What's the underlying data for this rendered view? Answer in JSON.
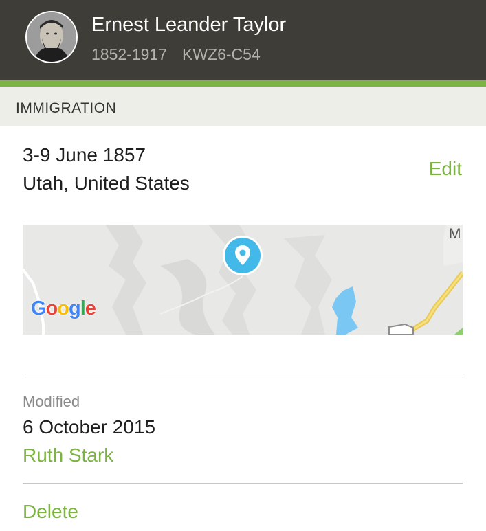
{
  "person": {
    "name": "Ernest Leander Taylor",
    "lifespan": "1852-1917",
    "pid": "KWZ6-C54"
  },
  "event": {
    "section_title": "IMMIGRATION",
    "date": "3-9 June 1857",
    "place": "Utah, United States",
    "edit_label": "Edit"
  },
  "map": {
    "brand": "Google",
    "corner_letter": "M",
    "pin_icon": "location-pin-icon"
  },
  "modified": {
    "label": "Modified",
    "date": "6 October 2015",
    "contributor": "Ruth Stark"
  },
  "actions": {
    "delete_label": "Delete"
  },
  "colors": {
    "header_bg": "#3e3d37",
    "accent_green": "#7cb342",
    "section_bg": "#eeeee8",
    "pin_blue": "#42b9e8"
  }
}
